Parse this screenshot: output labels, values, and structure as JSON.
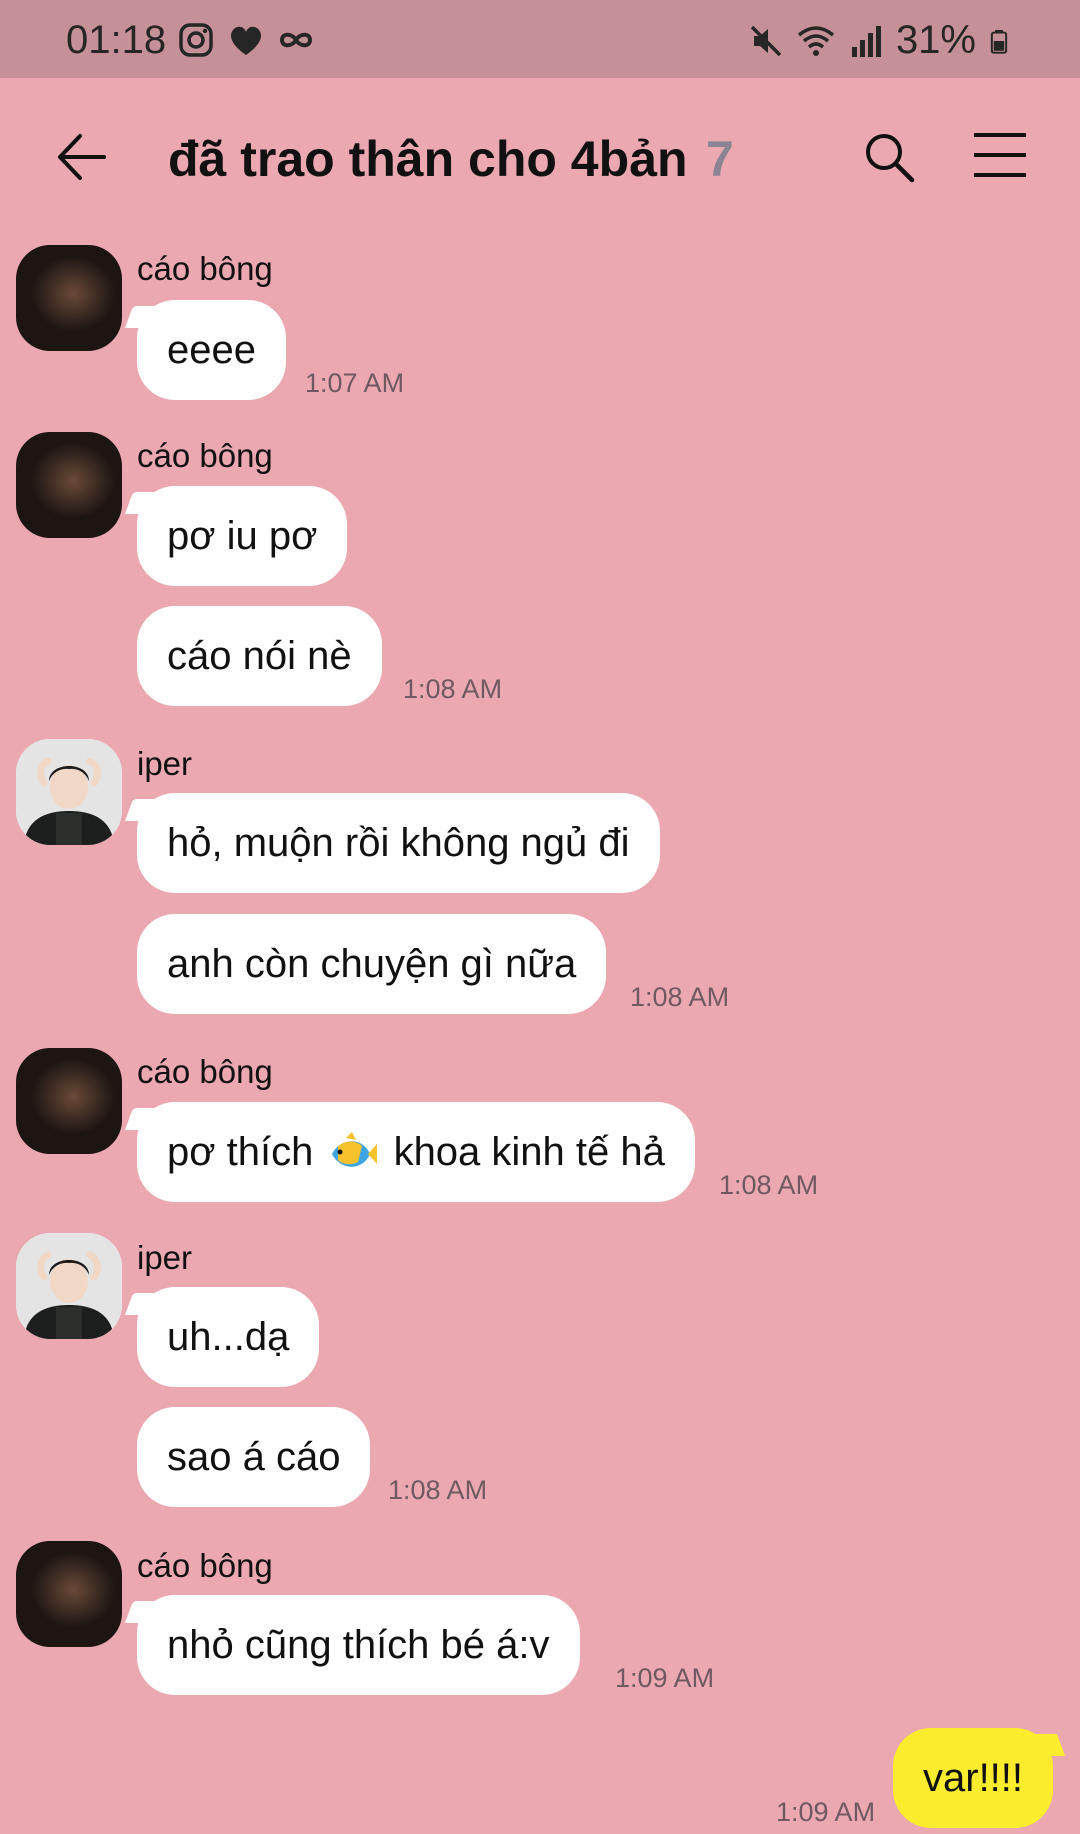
{
  "status_bar": {
    "time": "01:18",
    "left_icons": [
      "instagram-icon",
      "heart-icon",
      "infinity-icon"
    ],
    "right_icons": [
      "mute-icon",
      "wifi-icon",
      "signal-icon",
      "battery-icon"
    ],
    "battery": "31%"
  },
  "header": {
    "title": "đã trao thân cho 4bản",
    "member_count": "7",
    "icons": [
      "back-arrow-icon",
      "search-icon",
      "menu-icon"
    ]
  },
  "colors": {
    "background": "#eba8b1",
    "status_bar": "#c59097",
    "bubble_incoming": "#ffffff",
    "bubble_outgoing": "#fbec2e",
    "member_count": "#8b8593"
  },
  "messages": [
    {
      "sender": "cáo bông",
      "texts": [
        "eeee"
      ],
      "time": "1:07 AM"
    },
    {
      "sender": "cáo bông",
      "texts": [
        "pơ iu pơ",
        "cáo nói nè"
      ],
      "time": "1:08 AM"
    },
    {
      "sender": "iper",
      "texts": [
        "hỏ, muộn rồi không ngủ đi",
        "anh còn chuyện gì nữa"
      ],
      "time": "1:08 AM"
    },
    {
      "sender": "cáo bông",
      "texts_parts": [
        "pơ thích",
        "khoa kinh tế hả"
      ],
      "emoji": "tropical-fish-emoji",
      "time": "1:08 AM"
    },
    {
      "sender": "iper",
      "texts": [
        "uh...dạ",
        "sao á cáo"
      ],
      "time": "1:08 AM"
    },
    {
      "sender": "cáo bông",
      "texts": [
        "nhỏ cũng thích bé á:v"
      ],
      "time": "1:09 AM"
    },
    {
      "sender": "me",
      "texts": [
        "var!!!!"
      ],
      "time": "1:09 AM"
    }
  ]
}
